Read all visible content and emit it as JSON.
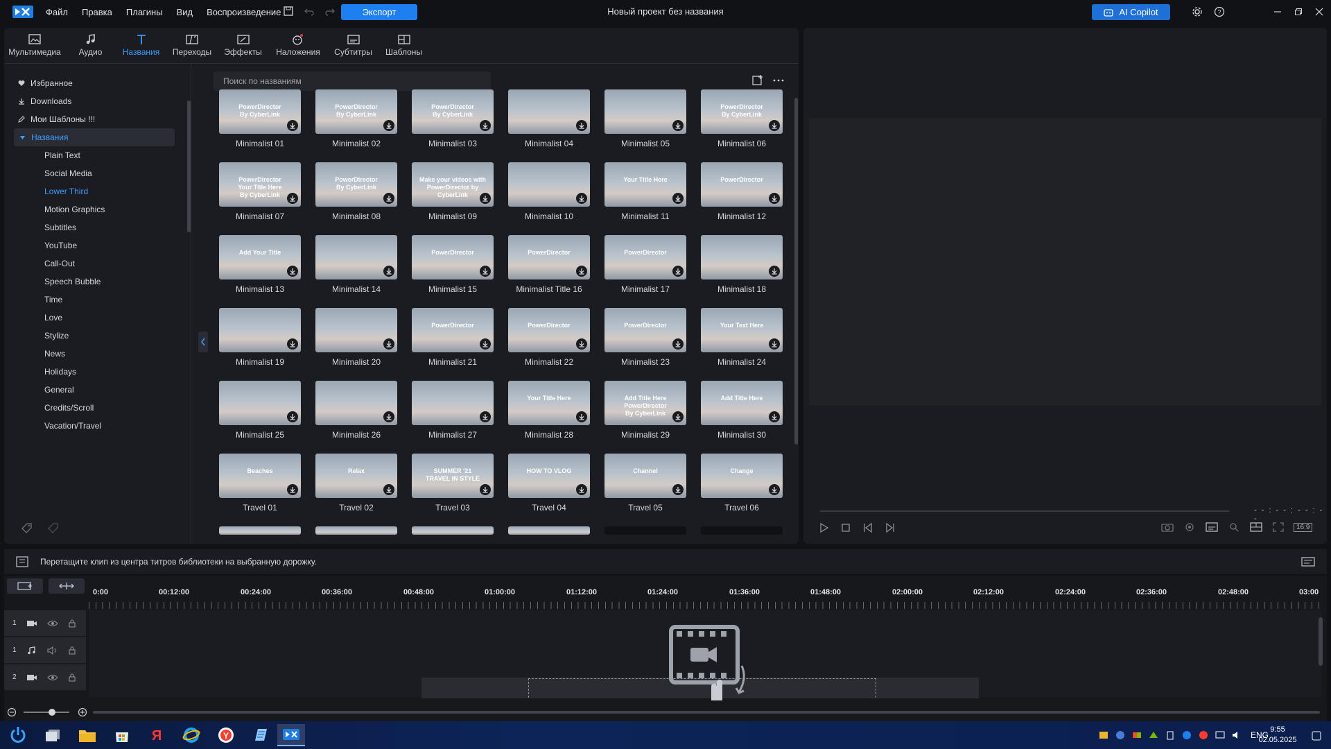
{
  "app": {
    "title": "Новый проект без названия",
    "menu": [
      "Файл",
      "Правка",
      "Плагины",
      "Вид",
      "Воспроизведение"
    ],
    "export_label": "Экспорт",
    "copilot_label": "AI Copilot"
  },
  "tabs": [
    {
      "label": "Мультимедиа",
      "icon": "media-icon"
    },
    {
      "label": "Аудио",
      "icon": "music-icon"
    },
    {
      "label": "Названия",
      "icon": "title-icon"
    },
    {
      "label": "Переходы",
      "icon": "transition-icon"
    },
    {
      "label": "Эффекты",
      "icon": "effects-icon"
    },
    {
      "label": "Наложения",
      "icon": "overlay-icon"
    },
    {
      "label": "Субтитры",
      "icon": "subtitles-icon"
    },
    {
      "label": "Шаблоны",
      "icon": "templates-icon"
    }
  ],
  "sidebar": {
    "items": [
      {
        "label": "Избранное",
        "icon": "heart-icon"
      },
      {
        "label": "Downloads",
        "icon": "download-icon"
      },
      {
        "label": "Мои Шаблоны !!!",
        "icon": "pencil-icon"
      },
      {
        "label": "Названия",
        "icon": "triangle-down-icon"
      }
    ],
    "subitems": [
      "Plain Text",
      "Social Media",
      "Lower Third",
      "Motion Graphics",
      "Subtitles",
      "YouTube",
      "Call-Out",
      "Speech Bubble",
      "Time",
      "Love",
      "Stylize",
      "News",
      "Holidays",
      "General",
      "Credits/Scroll",
      "Vacation/Travel"
    ]
  },
  "search": {
    "placeholder": "Поиск по названиям"
  },
  "thumbnails": [
    {
      "label": "Minimalist 01",
      "text": "PowerDirector\nBy CyberLink"
    },
    {
      "label": "Minimalist 02",
      "text": "PowerDirector\nBy CyberLink"
    },
    {
      "label": "Minimalist 03",
      "text": "PowerDirector\nBy CyberLink"
    },
    {
      "label": "Minimalist 04",
      "text": ""
    },
    {
      "label": "Minimalist 05",
      "text": ""
    },
    {
      "label": "Minimalist 06",
      "text": "PowerDirector\nBy CyberLink"
    },
    {
      "label": "Minimalist 07",
      "text": "PowerDirector\nYour Title Here\nBy CyberLink"
    },
    {
      "label": "Minimalist 08",
      "text": "PowerDirector\nBy CyberLink"
    },
    {
      "label": "Minimalist 09",
      "text": "Make your videos with\nPowerDirector by CyberLink"
    },
    {
      "label": "Minimalist 10",
      "text": ""
    },
    {
      "label": "Minimalist 11",
      "text": "Your Title Here"
    },
    {
      "label": "Minimalist 12",
      "text": "PowerDirector"
    },
    {
      "label": "Minimalist 13",
      "text": "Add Your Title"
    },
    {
      "label": "Minimalist 14",
      "text": ""
    },
    {
      "label": "Minimalist 15",
      "text": "PowerDirector"
    },
    {
      "label": "Minimalist Title 16",
      "text": "PowerDirector"
    },
    {
      "label": "Minimalist 17",
      "text": "PowerDirector"
    },
    {
      "label": "Minimalist 18",
      "text": ""
    },
    {
      "label": "Minimalist 19",
      "text": ""
    },
    {
      "label": "Minimalist 20",
      "text": ""
    },
    {
      "label": "Minimalist 21",
      "text": "PowerDirector"
    },
    {
      "label": "Minimalist 22",
      "text": "PowerDirector"
    },
    {
      "label": "Minimalist 23",
      "text": "PowerDirector"
    },
    {
      "label": "Minimalist 24",
      "text": "Your Text Here"
    },
    {
      "label": "Minimalist 25",
      "text": ""
    },
    {
      "label": "Minimalist 26",
      "text": ""
    },
    {
      "label": "Minimalist 27",
      "text": ""
    },
    {
      "label": "Minimalist 28",
      "text": "Your Title Here"
    },
    {
      "label": "Minimalist 29",
      "text": "Add Title Here\nPowerDirector\nBy CyberLink"
    },
    {
      "label": "Minimalist 30",
      "text": "Add Title Here"
    },
    {
      "label": "Travel 01",
      "text": "Beaches"
    },
    {
      "label": "Travel 02",
      "text": "Relax"
    },
    {
      "label": "Travel 03",
      "text": "SUMMER '21\nTRAVEL IN STYLE"
    },
    {
      "label": "Travel 04",
      "text": "HOW TO VLOG"
    },
    {
      "label": "Travel 05",
      "text": "Channel"
    },
    {
      "label": "Travel 06",
      "text": "Change"
    }
  ],
  "timeline": {
    "hint": "Перетащите клип из центра титров библиотеки на выбранную дорожку.",
    "ruler": [
      "0:00",
      "00:12:00",
      "00:24:00",
      "00:36:00",
      "00:48:00",
      "01:00:00",
      "01:12:00",
      "01:24:00",
      "01:36:00",
      "01:48:00",
      "02:00:00",
      "02:12:00",
      "02:24:00",
      "02:36:00",
      "02:48:00",
      "03:00"
    ],
    "tracks": [
      {
        "num": "1",
        "type": "video"
      },
      {
        "num": "1",
        "type": "audio"
      },
      {
        "num": "2",
        "type": "video"
      }
    ]
  },
  "preview": {
    "timecode": "- - : - - : - - : - -",
    "aspect": "16:9"
  },
  "taskbar": {
    "lang": "ENG",
    "time": "9:55",
    "date": "02.05.2025"
  },
  "colors": {
    "accent": "#3e9bff",
    "export": "#1e7ff0"
  }
}
